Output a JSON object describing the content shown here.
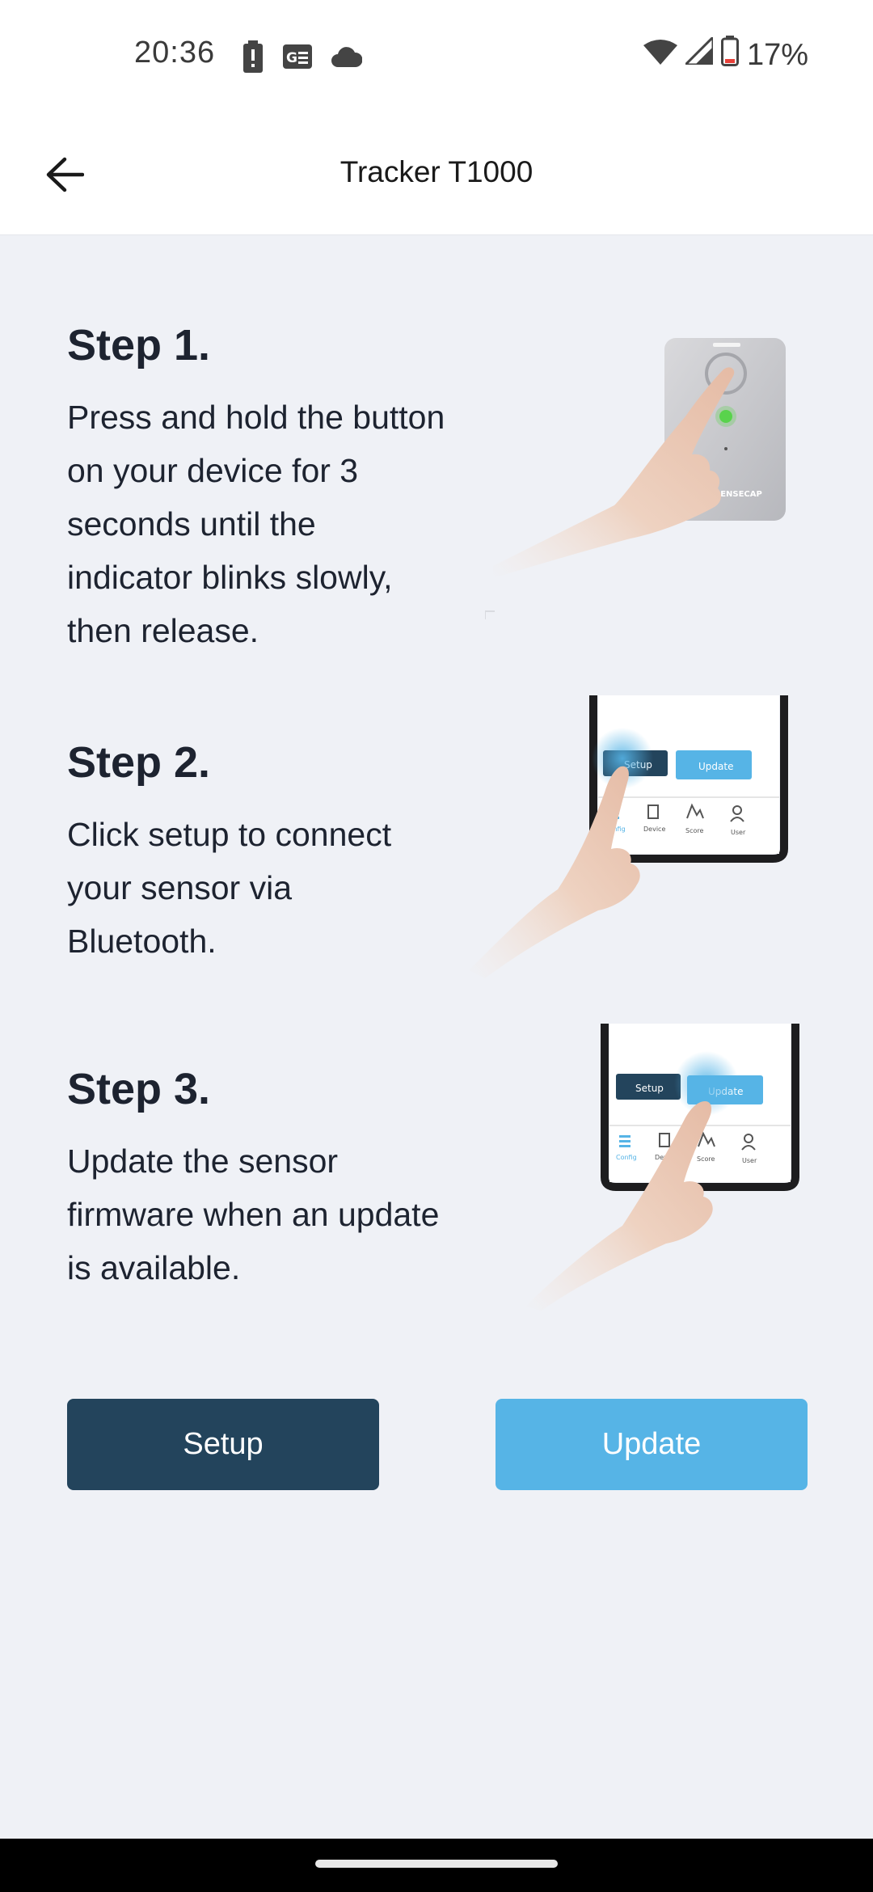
{
  "status_bar": {
    "time": "20:36",
    "battery": "17%",
    "icons": [
      "battery-alert-icon",
      "news-icon",
      "cloud-icon",
      "wifi-icon",
      "cell-signal-icon",
      "battery-icon"
    ]
  },
  "app_bar": {
    "title": "Tracker T1000",
    "back_icon": "arrow-back-icon"
  },
  "steps": [
    {
      "title": "Step 1.",
      "text": "Press and hold the button on your device for 3 seconds until the indicator blinks slowly, then release."
    },
    {
      "title": "Step 2.",
      "text": "Click setup to connect your sensor via Bluetooth."
    },
    {
      "title": "Step 3.",
      "text": "Update the sensor firmware when an update is available."
    }
  ],
  "illustrations": {
    "device_brand": "SENSECAP",
    "phone_buttons": [
      "Setup",
      "Update"
    ],
    "phone_tabs": [
      "Config",
      "Device",
      "Score",
      "User"
    ]
  },
  "actions": {
    "setup_label": "Setup",
    "update_label": "Update"
  },
  "colors": {
    "primary_dark": "#23445c",
    "primary_light": "#56b4e6",
    "background": "#eff1f6"
  }
}
